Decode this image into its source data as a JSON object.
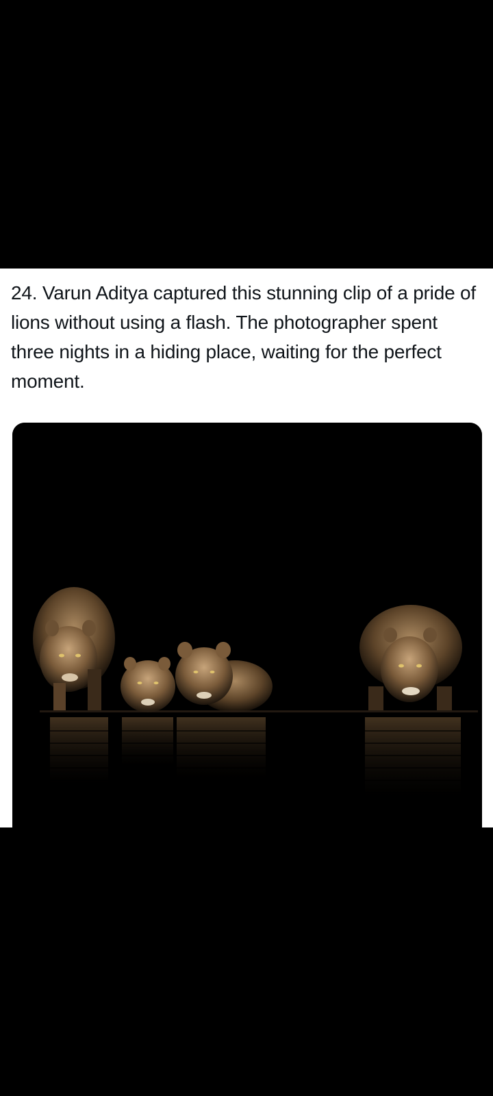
{
  "post": {
    "caption": "24. Varun Aditya captured this stunning clip of a pride of lions without using a flash. The photographer spent three nights in a hiding place, waiting for the perfect moment."
  },
  "colors": {
    "background": "#000000",
    "card": "#ffffff",
    "text": "#0f1419",
    "lion_fur": "#8a6a44",
    "lion_highlight": "#c9a57a"
  }
}
